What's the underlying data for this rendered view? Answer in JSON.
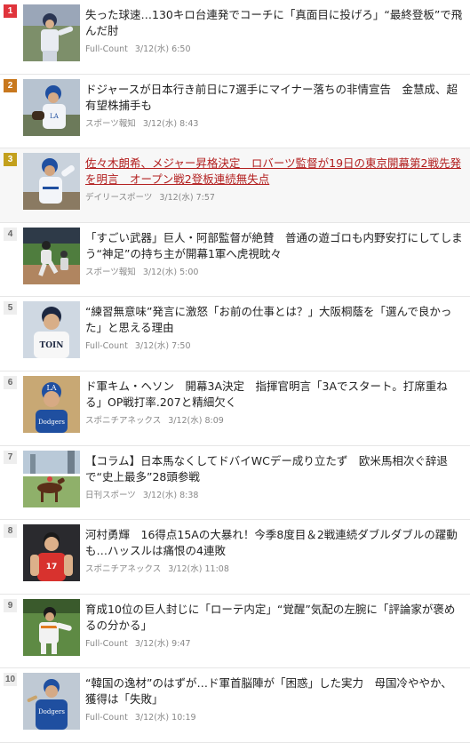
{
  "articles": [
    {
      "rank": "1",
      "title": "失った球速…130キロ台連発でコーチに「真面目に投げろ」“最終登板”で飛んだ肘",
      "source": "Full-Count",
      "time": "3/12(水) 6:50",
      "thumb_icon": "baseball-pitcher-photo"
    },
    {
      "rank": "2",
      "title": "ドジャースが日本行き前日に7選手にマイナー落ちの非情宣告　金慧成、超有望株捕手も",
      "source": "スポーツ報知",
      "time": "3/12(水) 8:43",
      "thumb_icon": "dodgers-player-photo"
    },
    {
      "rank": "3",
      "title": "佐々木朗希、メジャー昇格決定　ロバーツ監督が19日の東京開幕第2戦先発を明言　オープン戦2登板連続無失点",
      "source": "デイリースポーツ",
      "time": "3/12(水) 7:57",
      "thumb_icon": "dodgers-pitcher-photo"
    },
    {
      "rank": "4",
      "title": "「すごい武器」巨人・阿部監督が絶賛　普通の遊ゴロも内野安打にしてしまう“神足”の持ち主が開幕1軍へ虎視眈々",
      "source": "スポーツ報知",
      "time": "3/12(水) 5:00",
      "thumb_icon": "baseball-runner-photo"
    },
    {
      "rank": "5",
      "title": "“練習無意味”発言に激怒「お前の仕事とは？」大阪桐蔭を「選んで良かった」と思える理由",
      "source": "Full-Count",
      "time": "3/12(水) 7:50",
      "thumb_icon": "toin-player-photo"
    },
    {
      "rank": "6",
      "title": "ド軍キム・ヘソン　開幕3A決定　指揮官明言「3Aでスタート。打席重ねる」OP戦打率.207と精細欠く",
      "source": "スポニチアネックス",
      "time": "3/12(水) 8:09",
      "thumb_icon": "dodgers-infielder-photo"
    },
    {
      "rank": "7",
      "title": "【コラム】日本馬なくしてドバイWCデー成り立たず　欧米馬相次ぐ辞退で“史上最多”28頭参戦",
      "source": "日刊スポーツ",
      "time": "3/12(水) 8:38",
      "thumb_icon": "horse-race-photo"
    },
    {
      "rank": "8",
      "title": "河村勇輝　16得点15Aの大暴れ！今季8度目＆2戦連続ダブルダブルの躍動も…ハッスルは痛恨の4連敗",
      "source": "スポニチアネックス",
      "time": "3/12(水) 11:08",
      "thumb_icon": "basketball-player-photo"
    },
    {
      "rank": "9",
      "title": "育成10位の巨人封じに「ローテ内定」“覚醒”気配の左腕に「評論家が褒めるの分かる」",
      "source": "Full-Count",
      "time": "3/12(水) 9:47",
      "thumb_icon": "giants-pitcher-photo"
    },
    {
      "rank": "10",
      "title": "“韓国の逸材”のはずが…ド軍首脳陣が「困惑」した実力　母国冷ややか、獲得は「失敗」",
      "source": "Full-Count",
      "time": "3/12(水) 10:19",
      "thumb_icon": "dodgers-batter-photo"
    }
  ],
  "colors": {
    "rank1": "#e0343c",
    "rank2": "#c8781e",
    "rank3": "#c3a01c",
    "link_active": "#b32020",
    "text": "#222222",
    "meta": "#888888"
  }
}
